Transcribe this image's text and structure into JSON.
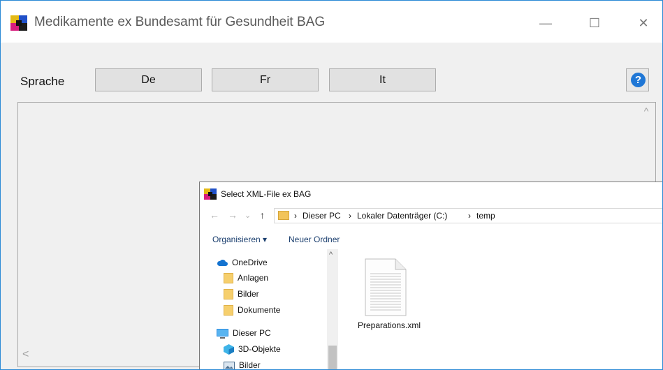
{
  "window": {
    "title": "Medikamente ex Bundesamt für Gesundheit BAG",
    "controls": {
      "minimize": "—",
      "maximize": "☐",
      "close": "✕"
    }
  },
  "toolbar": {
    "language_label": "Sprache",
    "buttons": [
      "De",
      "Fr",
      "It"
    ],
    "help_label": "?"
  },
  "content": {
    "scroll_up": "^",
    "scroll_left": "<"
  },
  "dialog": {
    "title": "Select XML-File ex BAG",
    "nav": {
      "back": "←",
      "forward": "→",
      "history": "⌄",
      "up": "↑"
    },
    "breadcrumb": [
      "Dieser PC",
      "Lokaler Datenträger (C:)",
      "temp"
    ],
    "breadcrumb_sep": "›",
    "commands": {
      "organize": "Organisieren ▾",
      "new_folder": "Neuer Ordner"
    },
    "tree": [
      {
        "label": "OneDrive",
        "icon": "cloud-icon"
      },
      {
        "label": "Anlagen",
        "icon": "folder-icon"
      },
      {
        "label": "Bilder",
        "icon": "folder-icon"
      },
      {
        "label": "Dokumente",
        "icon": "folder-icon"
      },
      {
        "label": "Dieser PC",
        "icon": "computer-icon"
      },
      {
        "label": "3D-Objekte",
        "icon": "cube-icon"
      },
      {
        "label": "Bilder",
        "icon": "pictures-icon"
      }
    ],
    "tree_scroll_up": "^",
    "files": [
      {
        "name": "Preparations.xml",
        "icon": "document-icon"
      }
    ]
  }
}
